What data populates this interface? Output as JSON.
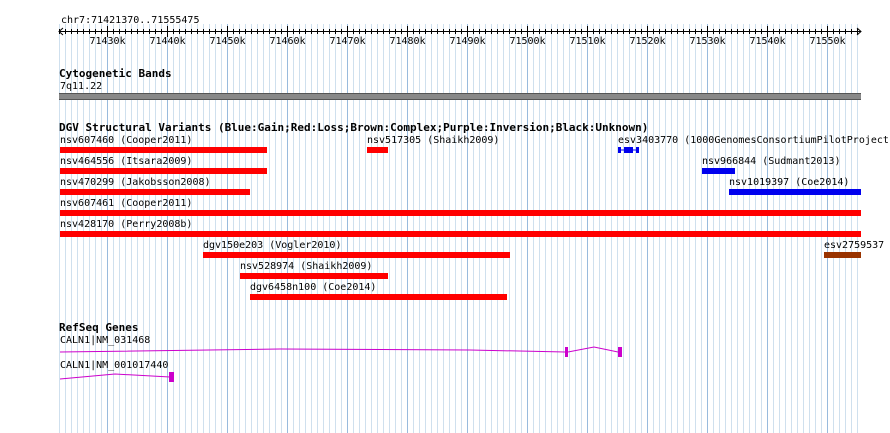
{
  "ruler": {
    "range_label": "chr7:71421370..71555475",
    "ticks": [
      "71430k",
      "71440k",
      "71450k",
      "71460k",
      "71470k",
      "71480k",
      "71490k",
      "71500k",
      "71510k",
      "71520k",
      "71530k",
      "71540k",
      "71550k"
    ]
  },
  "cytoband": {
    "title": "Cytogenetic Bands",
    "band": "7q11.22"
  },
  "dgv": {
    "title": "DGV Structural Variants (Blue:Gain;Red:Loss;Brown:Complex;Purple:Inversion;Black:Unknown)",
    "colors": {
      "loss": "#ff0000",
      "gain": "#0000ee",
      "complex": "#993300"
    },
    "features": [
      {
        "label": "nsv607460 (Cooper2011)",
        "type": "loss"
      },
      {
        "label": "nsv517305 (Shaikh2009)",
        "type": "loss"
      },
      {
        "label": "esv3403770 (1000GenomesConsortiumPilotProject)",
        "type": "gain"
      },
      {
        "label": "nsv464556 (Itsara2009)",
        "type": "loss"
      },
      {
        "label": "nsv966844 (Sudmant2013)",
        "type": "gain"
      },
      {
        "label": "nsv470299 (Jakobsson2008)",
        "type": "loss"
      },
      {
        "label": "nsv1019397 (Coe2014)",
        "type": "gain"
      },
      {
        "label": "nsv607461 (Cooper2011)",
        "type": "loss"
      },
      {
        "label": "nsv428170 (Perry2008b)",
        "type": "loss"
      },
      {
        "label": "dgv150e203 (Vogler2010)",
        "type": "loss"
      },
      {
        "label": "esv2759537",
        "type": "complex"
      },
      {
        "label": "nsv528974 (Shaikh2009)",
        "type": "loss"
      },
      {
        "label": "dgv6458n100 (Coe2014)",
        "type": "loss"
      }
    ]
  },
  "refseq": {
    "title": "RefSeq Genes",
    "color": "#cc00cc",
    "genes": [
      {
        "label": "CALN1|NM_031468"
      },
      {
        "label": "CALN1|NM_001017440"
      }
    ]
  }
}
